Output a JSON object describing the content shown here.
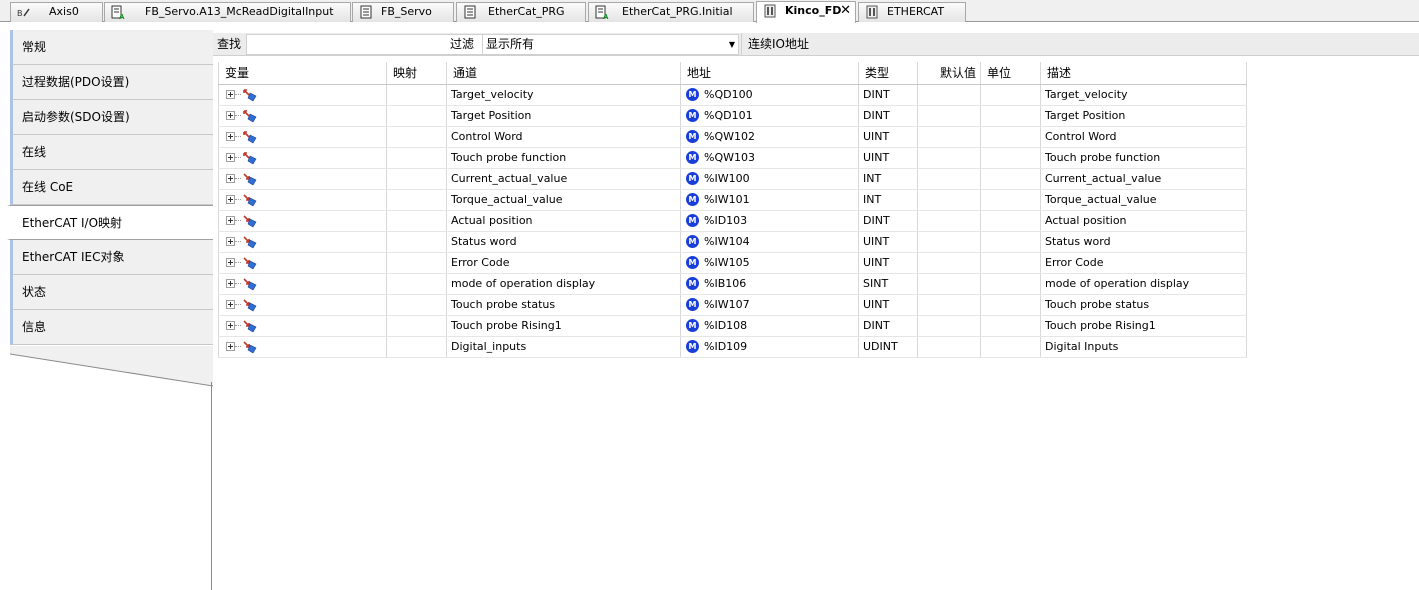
{
  "tabs": [
    {
      "label": "Axis0",
      "icon": "axis-icon",
      "active": false
    },
    {
      "label": "FB_Servo.A13_McReadDigitalInput",
      "icon": "action-icon",
      "active": false
    },
    {
      "label": "FB_Servo",
      "icon": "pou-icon",
      "active": false
    },
    {
      "label": "EtherCat_PRG",
      "icon": "pou-icon",
      "active": false
    },
    {
      "label": "EtherCat_PRG.Initial",
      "icon": "action-icon",
      "active": false
    },
    {
      "label": "Kinco_FD",
      "icon": "device-icon",
      "active": true,
      "close": "✕"
    },
    {
      "label": "ETHERCAT",
      "icon": "device-icon",
      "active": false
    }
  ],
  "nav": {
    "items": [
      {
        "label": "常规",
        "selected": false
      },
      {
        "label": "过程数据(PDO设置)",
        "selected": false
      },
      {
        "label": "启动参数(SDO设置)",
        "selected": false
      },
      {
        "label": "在线",
        "selected": false
      },
      {
        "label": "在线 CoE",
        "selected": false
      },
      {
        "label": "EtherCAT I/O映射",
        "selected": true
      },
      {
        "label": "EtherCAT IEC对象",
        "selected": false
      },
      {
        "label": "状态",
        "selected": false
      },
      {
        "label": "信息",
        "selected": false
      }
    ]
  },
  "filter": {
    "search_label": "查找",
    "search_value": "",
    "filter_label": "过滤",
    "filter_value": "显示所有",
    "continuous_label": "连续IO地址"
  },
  "table": {
    "headers": [
      "变量",
      "映射",
      "通道",
      "地址",
      "类型",
      "默认值",
      "单位",
      "描述"
    ],
    "rows": [
      {
        "dir": "output",
        "channel": "Target_velocity",
        "address": "%QD100",
        "type": "DINT",
        "desc": "Target_velocity"
      },
      {
        "dir": "output",
        "channel": "Target Position",
        "address": "%QD101",
        "type": "DINT",
        "desc": "Target Position"
      },
      {
        "dir": "output",
        "channel": "Control Word",
        "address": "%QW102",
        "type": "UINT",
        "desc": "Control Word"
      },
      {
        "dir": "output",
        "channel": "Touch probe function",
        "address": "%QW103",
        "type": "UINT",
        "desc": "Touch probe function"
      },
      {
        "dir": "input",
        "channel": "Current_actual_value",
        "address": "%IW100",
        "type": "INT",
        "desc": "Current_actual_value"
      },
      {
        "dir": "input",
        "channel": "Torque_actual_value",
        "address": "%IW101",
        "type": "INT",
        "desc": "Torque_actual_value"
      },
      {
        "dir": "input",
        "channel": "Actual position",
        "address": "%ID103",
        "type": "DINT",
        "desc": "Actual position"
      },
      {
        "dir": "input",
        "channel": "Status word",
        "address": "%IW104",
        "type": "UINT",
        "desc": "Status word"
      },
      {
        "dir": "input",
        "channel": "Error Code",
        "address": "%IW105",
        "type": "UINT",
        "desc": "Error Code"
      },
      {
        "dir": "input",
        "channel": "mode of operation display",
        "address": "%IB106",
        "type": "SINT",
        "desc": "mode of operation display"
      },
      {
        "dir": "input",
        "channel": "Touch probe status",
        "address": "%IW107",
        "type": "UINT",
        "desc": "Touch probe status"
      },
      {
        "dir": "input",
        "channel": "Touch probe Rising1",
        "address": "%ID108",
        "type": "DINT",
        "desc": "Touch probe Rising1"
      },
      {
        "dir": "input",
        "channel": "Digital_inputs",
        "address": "%ID109",
        "type": "UDINT",
        "desc": "Digital Inputs"
      }
    ],
    "mapping_badge": "M"
  },
  "colors": {
    "mapping_icon": "#1a3fd8",
    "output_arrow": "#c0392b",
    "input_arrow": "#c0392b",
    "variable_icon": "#2e6fd6",
    "nav_accent": "#a9c4e8"
  }
}
